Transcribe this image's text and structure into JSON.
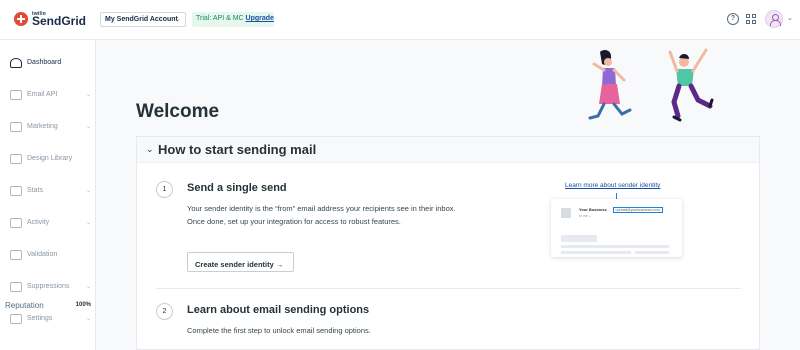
{
  "logo": {
    "small": "twilio",
    "big": "SendGrid"
  },
  "header": {
    "account": "My SendGrid Account",
    "trial": "Trial: API & MC",
    "upgrade": "Upgrade"
  },
  "icons": {
    "help": "?"
  },
  "sidebar": {
    "items": [
      {
        "label": "Dashboard",
        "active": true,
        "icon": "dashboard-icon"
      },
      {
        "label": "Email API",
        "chevron": true,
        "icon": "email-api-icon"
      },
      {
        "label": "Marketing",
        "chevron": true,
        "icon": "marketing-icon"
      },
      {
        "label": "Design Library",
        "icon": "design-library-icon"
      },
      {
        "label": "Stats",
        "chevron": true,
        "icon": "stats-icon"
      },
      {
        "label": "Activity",
        "chevron": true,
        "icon": "activity-icon"
      },
      {
        "label": "Validation",
        "icon": "validation-icon"
      },
      {
        "label": "Suppressions",
        "chevron": true,
        "icon": "suppressions-icon"
      },
      {
        "label": "Settings",
        "chevron": true,
        "icon": "settings-icon"
      }
    ],
    "reputation": {
      "label": "Reputation",
      "value": "100%"
    }
  },
  "main": {
    "welcome": "Welcome",
    "card": {
      "title": "How to start sending mail",
      "steps": [
        {
          "number": "1",
          "title": "Send a single send",
          "description": "Your sender identity is the “from” email address your recipients see in their inbox. Once done, set up your integration for access to robust features.",
          "button": "Create sender identity →",
          "link": "Learn more about sender identity"
        },
        {
          "number": "2",
          "title": "Learn about email sending options",
          "description": "Complete the first step to unlock email sending options."
        }
      ],
      "preview": {
        "business": "Your Business",
        "email": "<yemail@yourbusiness.com>",
        "to": "to me ⌄"
      }
    }
  },
  "colors": {
    "accent": "#1a82e2",
    "brand": "#e44938",
    "trial_bg": "#e6f7ee",
    "trial_text": "#18875b"
  }
}
